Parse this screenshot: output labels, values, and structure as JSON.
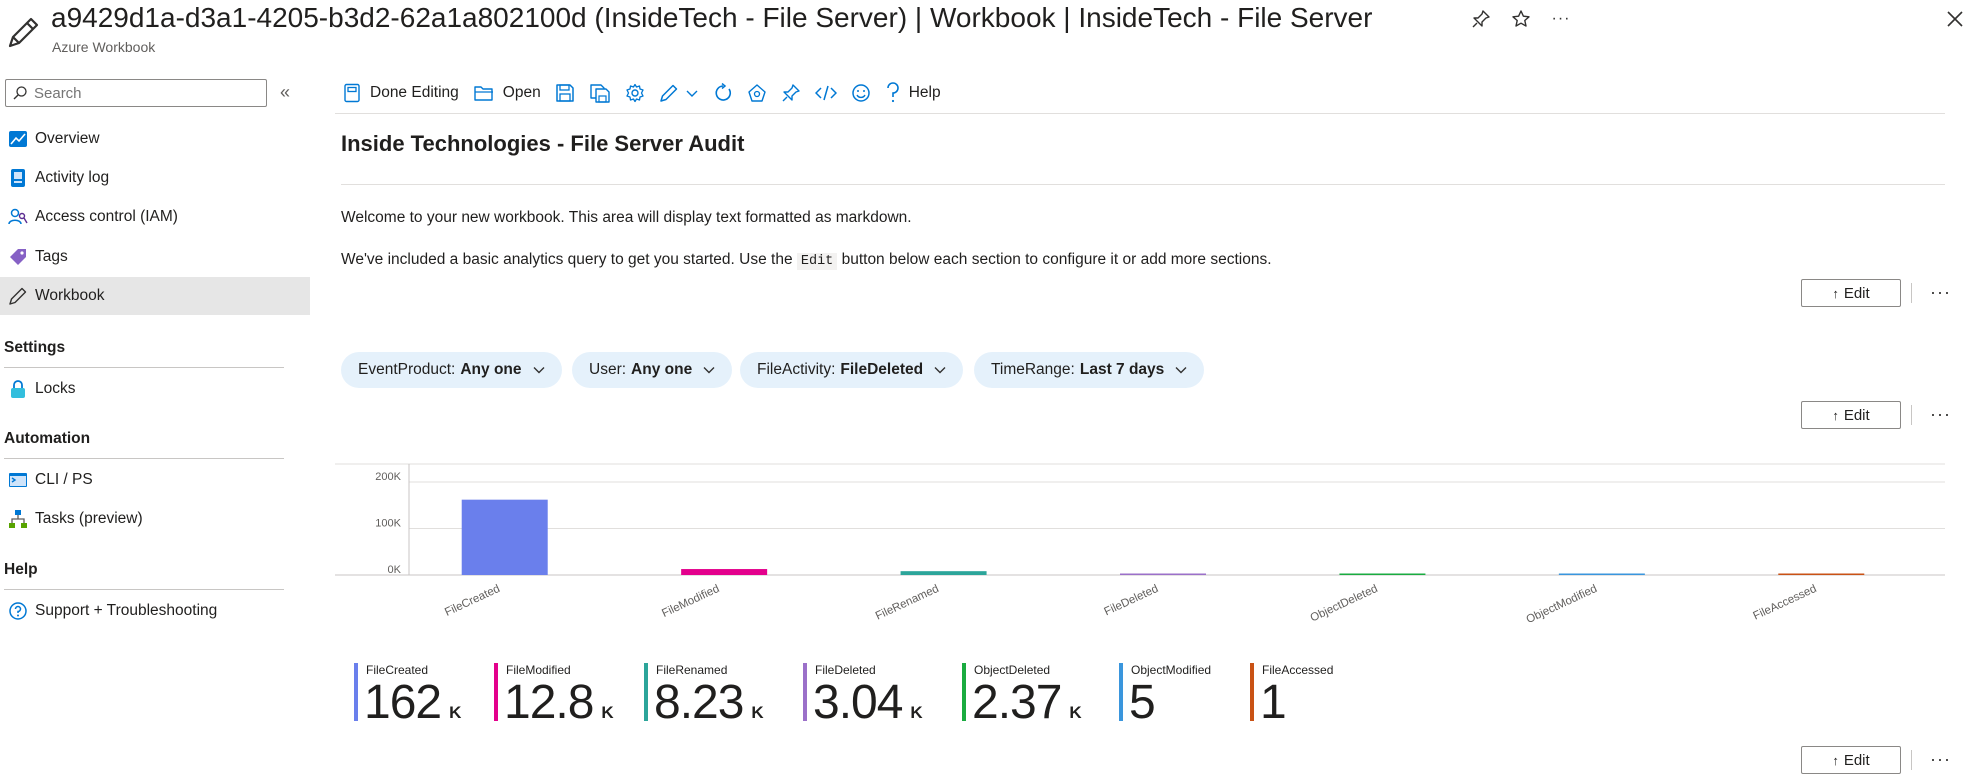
{
  "window": {
    "title": "a9429d1a-d3a1-4205-b3d2-62a1a802100d (InsideTech - File Server) | Workbook | InsideTech - File Server",
    "subtitle": "Azure Workbook"
  },
  "sidebar": {
    "search_placeholder": "Search",
    "items": [
      {
        "label": "Overview",
        "icon": "overview-icon"
      },
      {
        "label": "Activity log",
        "icon": "activity-log-icon"
      },
      {
        "label": "Access control (IAM)",
        "icon": "iam-icon"
      },
      {
        "label": "Tags",
        "icon": "tag-icon"
      },
      {
        "label": "Workbook",
        "icon": "pencil-icon",
        "active": true
      }
    ],
    "sections": [
      {
        "title": "Settings",
        "items": [
          {
            "label": "Locks",
            "icon": "lock-icon"
          }
        ]
      },
      {
        "title": "Automation",
        "items": [
          {
            "label": "CLI / PS",
            "icon": "terminal-icon"
          },
          {
            "label": "Tasks (preview)",
            "icon": "tasks-icon"
          }
        ]
      },
      {
        "title": "Help",
        "items": [
          {
            "label": "Support + Troubleshooting",
            "icon": "help-circle-icon"
          }
        ]
      }
    ]
  },
  "toolbar": {
    "done_editing": "Done Editing",
    "open": "Open",
    "help": "Help"
  },
  "main": {
    "title": "Inside Technologies - File Server Audit",
    "p1": "Welcome to your new workbook. This area will display text formatted as markdown.",
    "p2_before": "We've included a basic analytics query to get you started. Use the ",
    "p2_code": "Edit",
    "p2_after": " button below each section to configure it or add more sections.",
    "edit_label": "Edit",
    "more_label": "···"
  },
  "parameters": [
    {
      "name": "EventProduct:",
      "value": "Any one"
    },
    {
      "name": "User:",
      "value": "Any one"
    },
    {
      "name": "FileActivity:",
      "value": "FileDeleted"
    },
    {
      "name": "TimeRange:",
      "value": "Last 7 days"
    }
  ],
  "chart_data": {
    "type": "bar",
    "categories": [
      "FileCreated",
      "FileModified",
      "FileRenamed",
      "FileDeleted",
      "ObjectDeleted",
      "ObjectModified",
      "FileAccessed"
    ],
    "values": [
      162000,
      12800,
      8230,
      3040,
      2370,
      5,
      1
    ],
    "colors": [
      "#6a7fec",
      "#e3008c",
      "#2ca59a",
      "#9b70c9",
      "#1aab40",
      "#3a96dd",
      "#c95215"
    ],
    "ylim": [
      0,
      200000
    ],
    "yticks": [
      "0K",
      "100K",
      "200K"
    ],
    "title": "",
    "xlabel": "",
    "ylabel": ""
  },
  "tiles": [
    {
      "label": "FileCreated",
      "value": "162",
      "unit": "K",
      "color": "#6a7fec"
    },
    {
      "label": "FileModified",
      "value": "12.8",
      "unit": "K",
      "color": "#e3008c"
    },
    {
      "label": "FileRenamed",
      "value": "8.23",
      "unit": "K",
      "color": "#2ca59a"
    },
    {
      "label": "FileDeleted",
      "value": "3.04",
      "unit": "K",
      "color": "#9b70c9"
    },
    {
      "label": "ObjectDeleted",
      "value": "2.37",
      "unit": "K",
      "color": "#1aab40"
    },
    {
      "label": "ObjectModified",
      "value": "5",
      "unit": "",
      "color": "#3a96dd"
    },
    {
      "label": "FileAccessed",
      "value": "1",
      "unit": "",
      "color": "#c95215"
    }
  ]
}
